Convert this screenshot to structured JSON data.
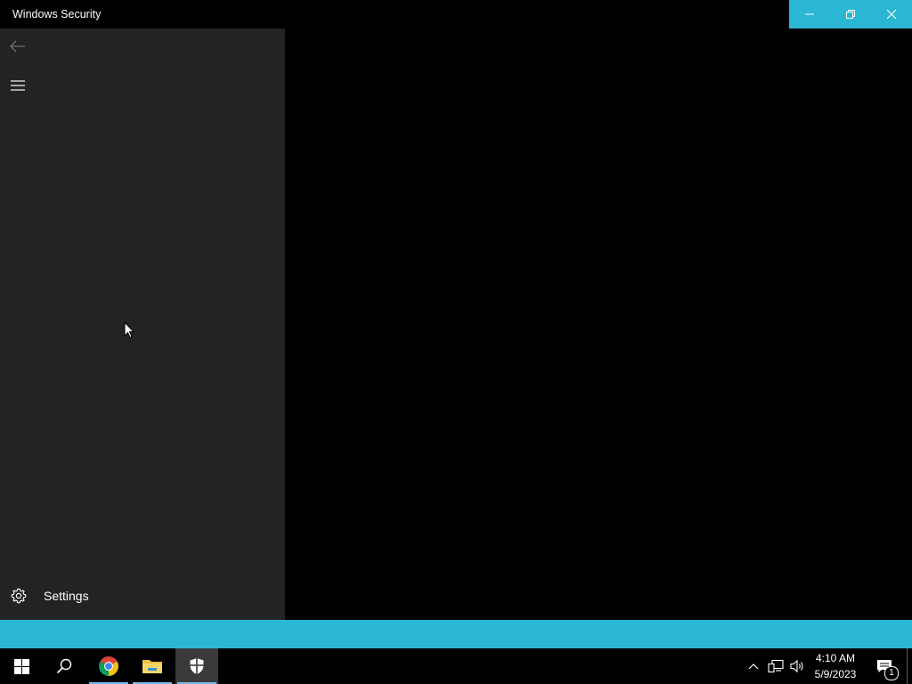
{
  "window": {
    "title": "Windows Security",
    "accent_color": "#2bb7d3",
    "controls": {
      "minimize_icon": "minimize-icon",
      "restore_icon": "restore-icon",
      "close_icon": "close-icon"
    }
  },
  "sidebar": {
    "background": "#232323",
    "back_icon": "back-arrow-icon",
    "menu_icon": "hamburger-menu-icon",
    "settings": {
      "label": "Settings",
      "icon": "gear-icon"
    }
  },
  "taskbar": {
    "items": [
      {
        "name": "start",
        "icon": "windows-start-icon"
      },
      {
        "name": "search",
        "icon": "search-icon"
      },
      {
        "name": "chrome",
        "icon": "chrome-icon"
      },
      {
        "name": "file-explorer",
        "icon": "folder-icon"
      },
      {
        "name": "windows-security",
        "icon": "shield-icon",
        "active": true
      }
    ],
    "tray": {
      "chevron_icon": "chevron-up-icon",
      "network_icon": "network-icon",
      "volume_icon": "volume-icon",
      "time": "4:10 AM",
      "date": "5/9/2023",
      "notification_count": "1"
    }
  }
}
